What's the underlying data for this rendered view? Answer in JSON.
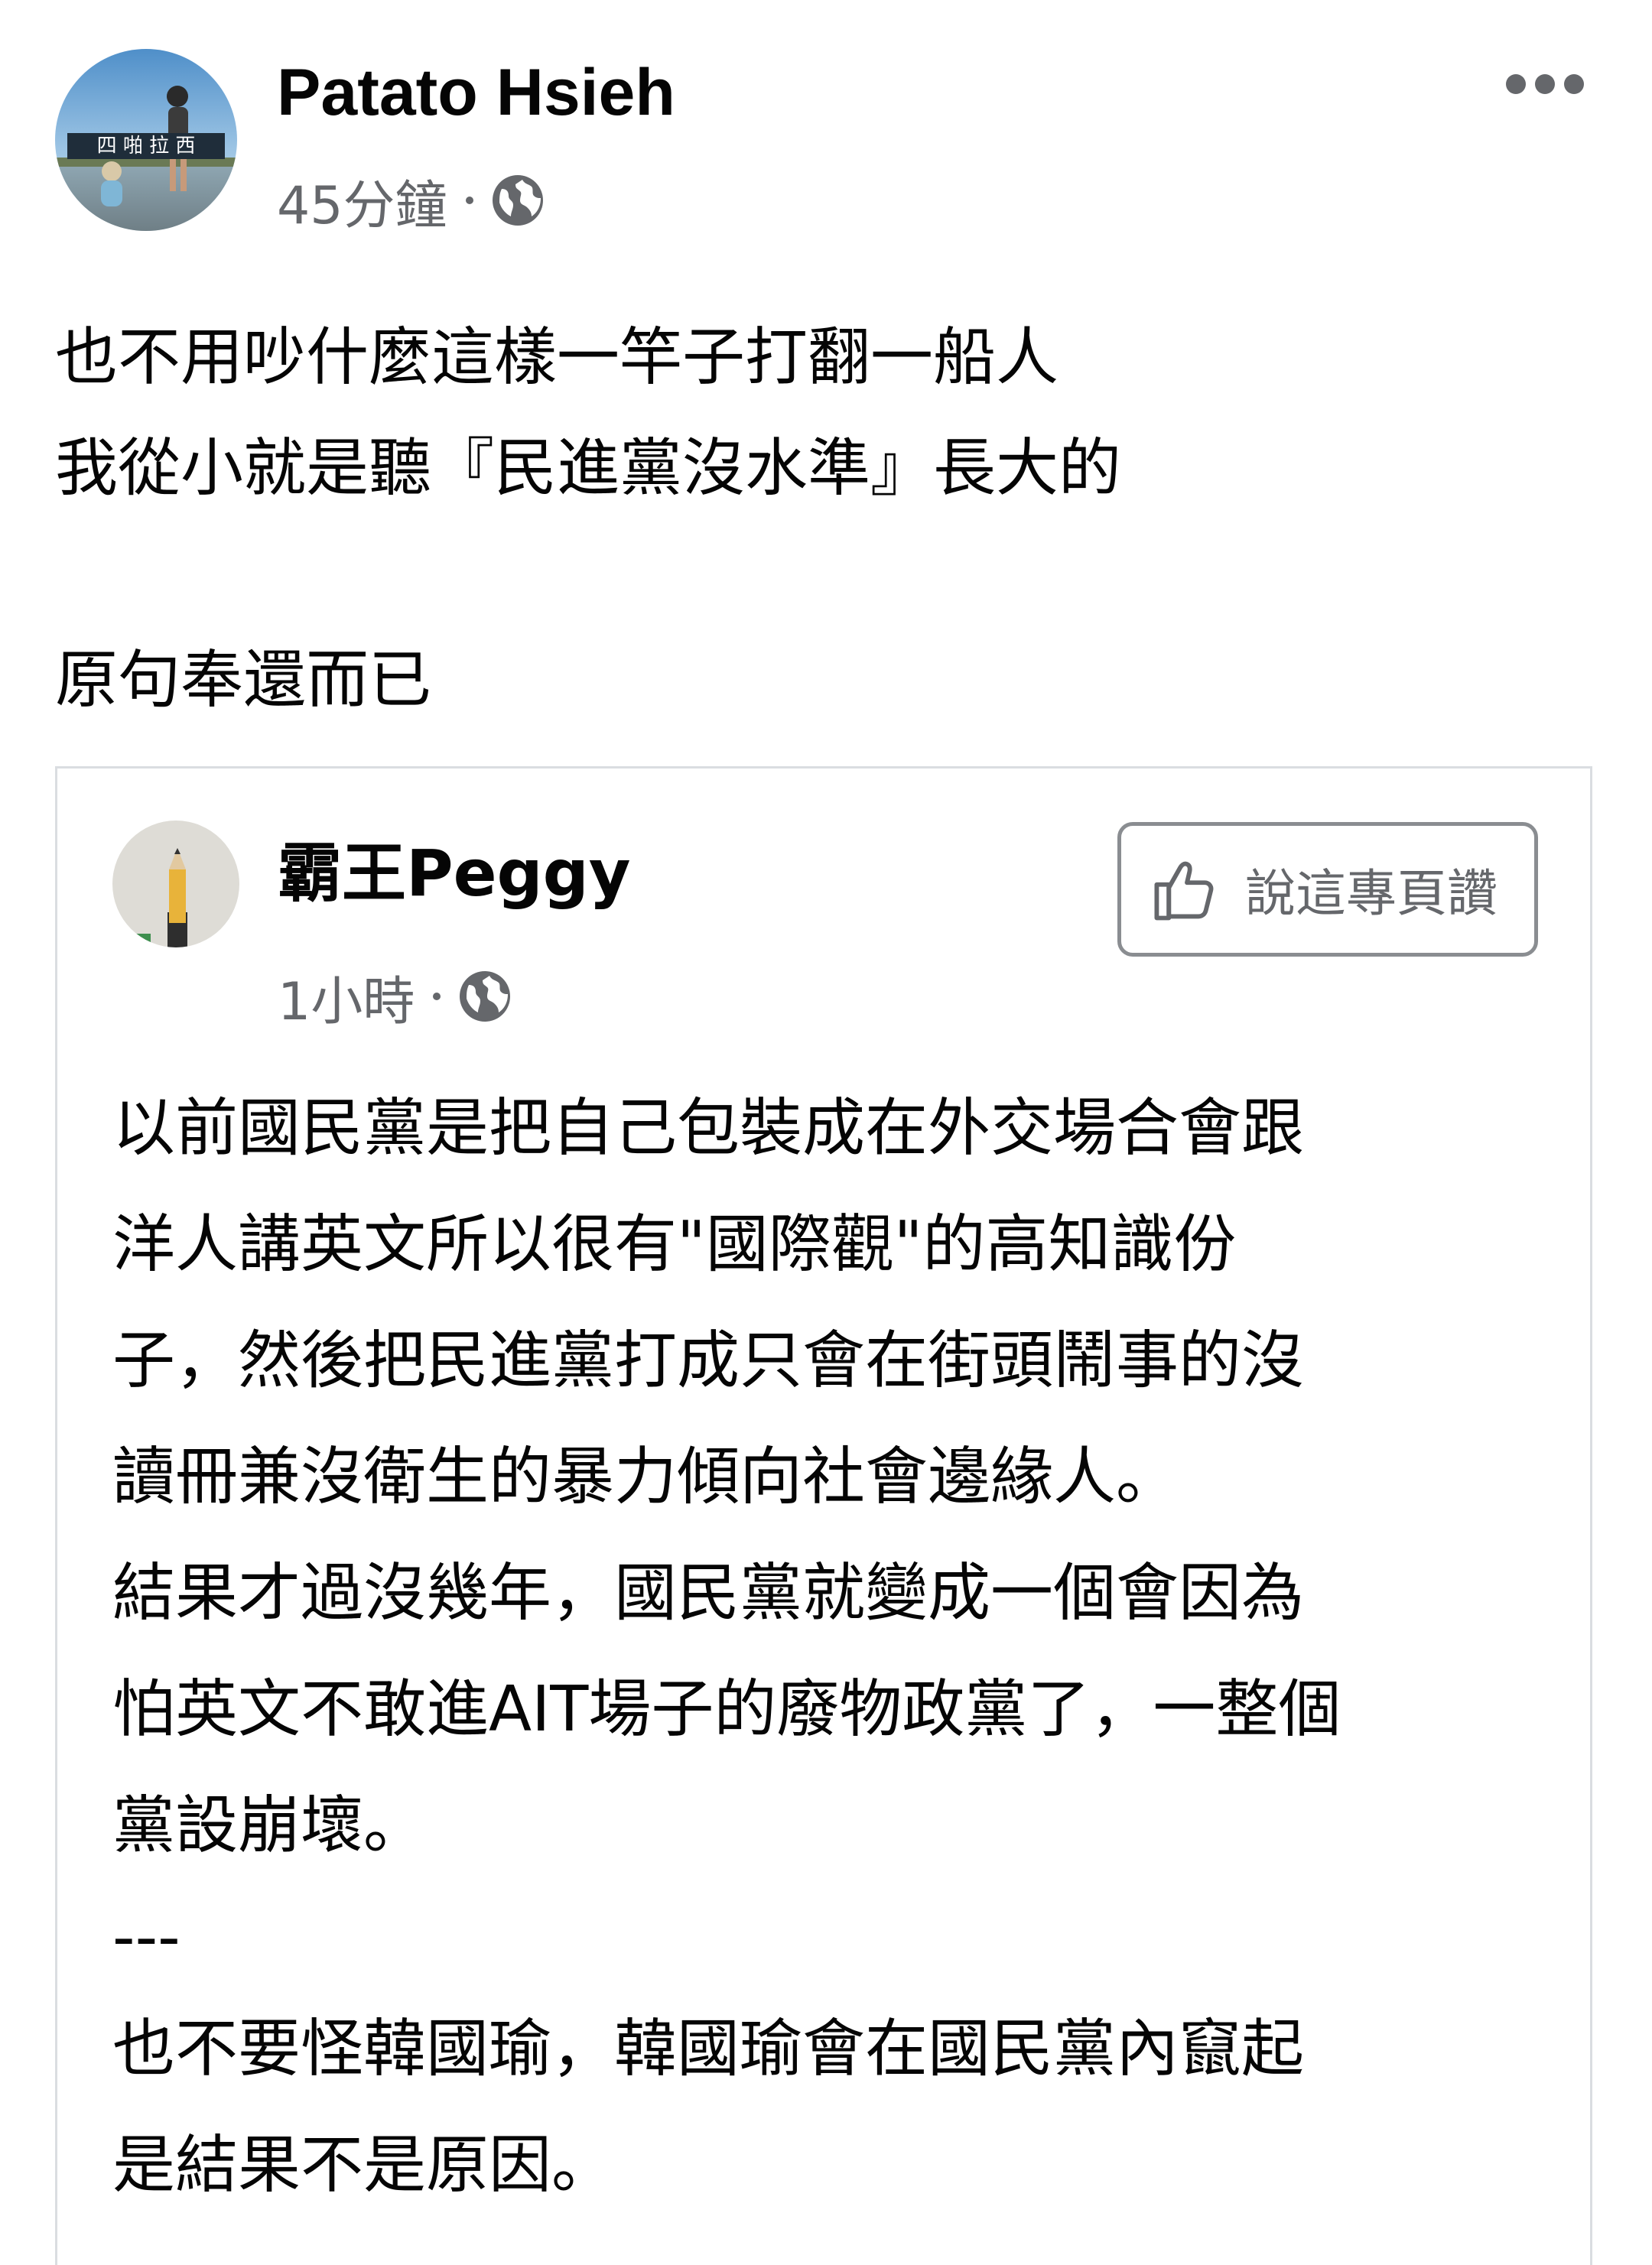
{
  "post": {
    "author": "Patato Hsieh",
    "avatar_caption": "四 啪 拉 西",
    "time": "45分鐘",
    "privacy_icon": "globe-icon",
    "text_lines": [
      "也不用吵什麼這樣一竿子打翻一船人",
      "我從小就是聽『民進黨沒水準』長大的",
      "",
      "原句奉還而已"
    ]
  },
  "shared": {
    "author": "霸王Peggy",
    "time": "1小時",
    "privacy_icon": "globe-icon",
    "like_page_label": "說這專頁讚",
    "body_lines": [
      "以前國民黨是把自己包裝成在外交場合會跟",
      "洋人講英文所以很有\"國際觀\"的高知識份",
      "子，然後把民進黨打成只會在街頭鬧事的沒",
      "讀冊兼沒衛生的暴力傾向社會邊緣人。",
      "結果才過沒幾年，國民黨就變成一個會因為",
      "怕英文不敢進AIT場子的廢物政黨了，一整個",
      "黨設崩壞。",
      "---",
      "也不要怪韓國瑜，韓國瑜會在國民黨內竄起",
      "是結果不是原因。"
    ]
  },
  "colors": {
    "text": "#050505",
    "secondary": "#65676b",
    "card_border": "#dadde1"
  }
}
